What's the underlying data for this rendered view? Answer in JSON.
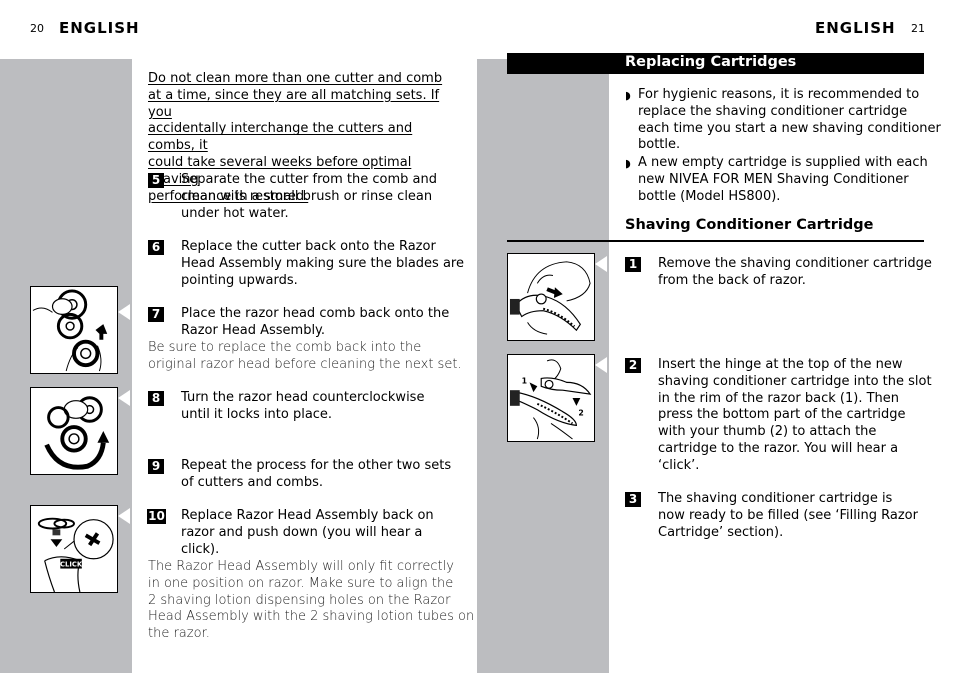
{
  "left_page": {
    "page_number": "20",
    "language": "ENGLISH",
    "warning_lines": [
      "Do not clean more than one cutter and comb",
      "at a time, since they are all matching sets.  If you",
      "accidentally interchange the cutters and combs, it",
      "could take several weeks before optimal shaving",
      "performance is restored."
    ],
    "steps": [
      {
        "number": "5",
        "lines": [
          "Separate the cutter from the comb and",
          "clean with a small brush or rinse clean",
          "under hot water."
        ]
      },
      {
        "number": "6",
        "lines": [
          "Replace the cutter back onto the Razor",
          "Head Assembly making sure the blades are",
          "pointing upwards."
        ]
      },
      {
        "number": "7",
        "lines": [
          "Place the razor head comb back onto the",
          "Razor Head Assembly."
        ],
        "note_lines": [
          "Be sure to replace the comb back into the",
          "original razor head  before cleaning the next set."
        ]
      },
      {
        "number": "8",
        "lines": [
          "Turn the razor head counterclockwise",
          "until it locks into place."
        ]
      },
      {
        "number": "9",
        "lines": [
          "Repeat the process for the other two sets",
          "of cutters and combs."
        ]
      },
      {
        "number": "10",
        "lines": [
          "Replace Razor Head Assembly back on",
          "razor and push down (you will hear a",
          "click)."
        ],
        "note_lines": [
          "The Razor Head Assembly will only fit correctly",
          "in one position on razor.  Make sure to align the",
          "2 shaving lotion dispensing holes on the Razor",
          "Head Assembly with the 2 shaving lotion tubes on",
          "the razor."
        ]
      }
    ],
    "figures": [
      {
        "name": "insert-comb-illustration"
      },
      {
        "name": "turn-counterclockwise-illustration"
      },
      {
        "name": "push-down-click-illustration",
        "label": "CLICK"
      }
    ]
  },
  "right_page": {
    "page_number": "21",
    "language": "ENGLISH",
    "section_title": "Replacing Cartridges",
    "bullets": [
      {
        "lines": [
          "For hygienic reasons, it is recommended to",
          "replace the shaving conditioner cartridge",
          "each time you start a new shaving conditioner",
          "bottle."
        ]
      },
      {
        "lines": [
          "A new empty cartridge is supplied with each",
          "new NIVEA FOR MEN Shaving Conditioner",
          "bottle (Model HS800)."
        ]
      }
    ],
    "subsection_title": "Shaving Conditioner Cartridge",
    "steps": [
      {
        "number": "1",
        "lines": [
          "Remove the shaving conditioner cartridge",
          "from the back of razor."
        ]
      },
      {
        "number": "2",
        "lines": [
          "Insert the hinge at the top of the new",
          "shaving conditioner cartridge into the slot",
          "in the rim of the razor back (1). Then",
          "press the bottom part of the cartridge",
          "with your thumb (2) to attach the",
          "cartridge to the razor. You will hear a",
          "‘click’."
        ]
      },
      {
        "number": "3",
        "lines": [
          "The shaving conditioner cartridge is",
          "now ready to be filled (see ‘Filling Razor",
          "Cartridge’ section)."
        ]
      }
    ],
    "figures": [
      {
        "name": "remove-cartridge-illustration"
      },
      {
        "name": "insert-cartridge-illustration",
        "labels": [
          "1",
          "2"
        ]
      }
    ]
  },
  "bullet_icon": "◗"
}
